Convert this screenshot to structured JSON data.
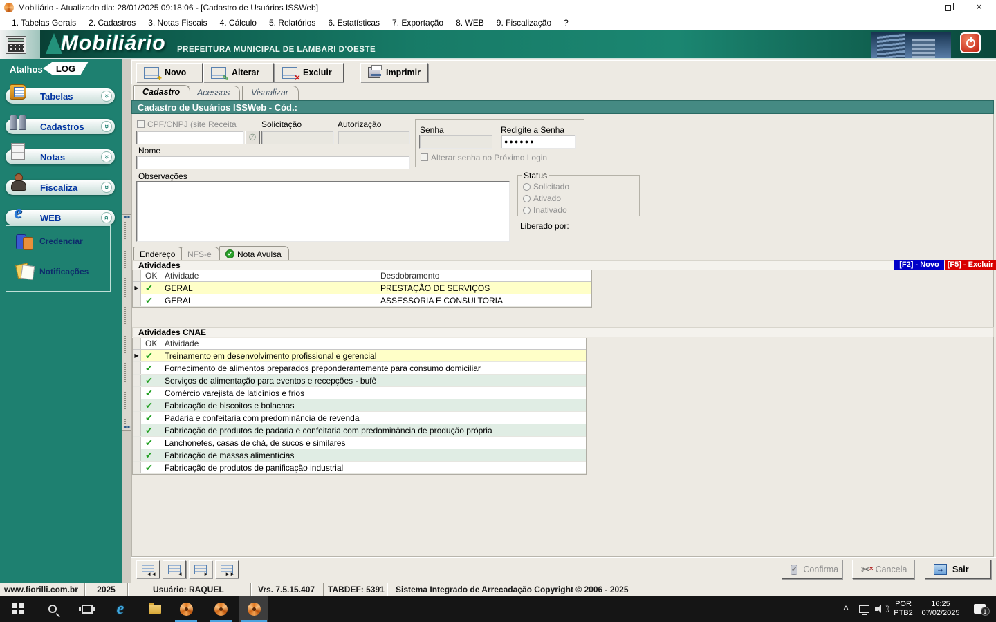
{
  "window": {
    "title": "Mobiliário - Atualizado dia: 28/01/2025 09:18:06 - [Cadastro de Usuários ISSWeb]"
  },
  "menubar": {
    "items": [
      "1. Tabelas Gerais",
      "2. Cadastros",
      "3. Notas Fiscais",
      "4. Cálculo",
      "5. Relatórios",
      "6. Estatísticas",
      "7. Exportação",
      "8. WEB",
      "9. Fiscalização",
      "?"
    ]
  },
  "banner": {
    "logo": "Mobiliário",
    "subtitle": "PREFEITURA MUNICIPAL DE LAMBARI D'OESTE"
  },
  "sidebar": {
    "header": "Atalhos",
    "log_badge": "LOG",
    "items": [
      {
        "label": "Tabelas"
      },
      {
        "label": "Cadastros"
      },
      {
        "label": "Notas"
      },
      {
        "label": "Fiscaliza"
      },
      {
        "label": "WEB"
      }
    ],
    "web_children": [
      {
        "label": "Credenciar"
      },
      {
        "label": "Notificações"
      }
    ]
  },
  "toolbar": {
    "buttons": [
      {
        "label": "Novo"
      },
      {
        "label": "Alterar"
      },
      {
        "label": "Excluir"
      },
      {
        "label": "Imprimir"
      }
    ]
  },
  "tabs": [
    {
      "label": "Cadastro"
    },
    {
      "label": "Acessos"
    },
    {
      "label": "Visualizar"
    }
  ],
  "form": {
    "title": "Cadastro de Usuários ISSWeb - Cód.:",
    "cpf_label": "CPF/CNPJ (site Receita",
    "solicitacao_label": "Solicitação",
    "autorizacao_label": "Autorização",
    "senha_label": "Senha",
    "redigite_label": "Redigite a Senha",
    "senha_value": "●●●●●●",
    "alterar_senha_label": "Alterar senha no Próximo Login",
    "nome_label": "Nome",
    "observacoes_label": "Observações",
    "status_label": "Status",
    "status_options": [
      "Solicitado",
      "Ativado",
      "Inativado"
    ],
    "liberado_label": "Liberado por:"
  },
  "subtabs": [
    {
      "label": "Endereço"
    },
    {
      "label": "NFS-e"
    },
    {
      "label": "Nota Avulsa"
    }
  ],
  "badges": {
    "f2": "[F2] - Novo",
    "f5": "[F5] - Excluir"
  },
  "sections": {
    "atividades": {
      "title": "Atividades",
      "columns": [
        "OK",
        "Atividade",
        "Desdobramento"
      ],
      "rows": [
        {
          "atividade": "GERAL",
          "desdobramento": "PRESTAÇÃO DE SERVIÇOS"
        },
        {
          "atividade": "GERAL",
          "desdobramento": "ASSESSORIA E CONSULTORIA"
        }
      ]
    },
    "cnae": {
      "title": "Atividades CNAE",
      "columns": [
        "OK",
        "Atividade"
      ],
      "rows": [
        {
          "atividade": "Treinamento em desenvolvimento profissional e gerencial"
        },
        {
          "atividade": "Fornecimento de alimentos preparados preponderantemente para consumo domiciliar"
        },
        {
          "atividade": "Serviços de alimentação para eventos e recepções - bufê"
        },
        {
          "atividade": "Comércio varejista de laticínios e frios"
        },
        {
          "atividade": "Fabricação de biscoitos e bolachas"
        },
        {
          "atividade": "Padaria e confeitaria com predominância de revenda"
        },
        {
          "atividade": "Fabricação de produtos de padaria e confeitaria com predominância de produção própria"
        },
        {
          "atividade": "Lanchonetes, casas de chá, de sucos e similares"
        },
        {
          "atividade": "Fabricação de massas alimentícias"
        },
        {
          "atividade": "Fabricação de produtos de panificação industrial"
        }
      ]
    }
  },
  "footer": {
    "confirma": "Confirma",
    "cancela": "Cancela",
    "sair": "Sair"
  },
  "statusbar": {
    "panels": [
      "www.fiorilli.com.br",
      "2025",
      "Usuário: RAQUEL",
      "Vrs. 7.5.15.407",
      "TABDEF: 5391",
      "Sistema Integrado de Arrecadação Copyright © 2006 - 2025"
    ]
  },
  "taskbar": {
    "lang_top": "POR",
    "lang_bottom": "PTB2",
    "time": "16:25",
    "date": "07/02/2025",
    "notification_count": "1"
  },
  "icons": {
    "check": "✔",
    "marker": "▶",
    "chevron": "»",
    "close": "×",
    "plus": "+",
    "pencil": "✎",
    "cross": "×",
    "scissors": "✂",
    "exit_arrow": "→",
    "nav_first": "◄◄",
    "nav_prev": "◄",
    "nav_next": "►",
    "nav_last": "►►",
    "splitter_arrows": "◄►",
    "thumb_check": "✔",
    "disabled_globe": "∅"
  },
  "colors": {
    "teal_header": "#458A83",
    "sidebar_teal": "#1E8070",
    "selected_row": "#FFFFC8",
    "alt_row": "#E0EDE4",
    "badge_blue": "#0000C8",
    "badge_red": "#D80000",
    "check_green": "#1E9E1E"
  }
}
